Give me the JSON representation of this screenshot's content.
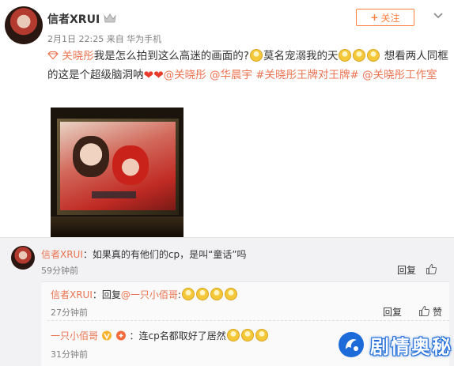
{
  "post": {
    "author": "信者XRUI",
    "meta": "2月1日 22:25 来自 华为手机",
    "follow_label": "关注",
    "tag_link": "关晓彤",
    "text_1": "我是怎么拍到这么高迷的画面的?",
    "text_2": "莫名宠溺我的天",
    "text_3": " 想看两人同框的这是个超级脑洞呐",
    "mentions": [
      "@关晓彤",
      "@华晨宇",
      "#关晓彤王牌对王牌#",
      "@关晓彤工作室"
    ]
  },
  "comment": {
    "author": "信者XRUI",
    "text": "：如果真的有他们的cp，是叫“童话”吗",
    "time": "59分钟前",
    "reply_label": "回复"
  },
  "replies": [
    {
      "author": "信者XRUI",
      "prefix": "：回复",
      "target": "@一只小佰哥",
      "text": ":",
      "time": "27分钟前",
      "reply_label": "回复",
      "like_label": "赞"
    },
    {
      "author": "一只小佰哥",
      "text": "：连cp名都取好了居然",
      "time": "31分钟前"
    }
  ],
  "watermark": {
    "text": "剧情奥秘"
  },
  "colors": {
    "link": "#eb7350",
    "follow": "#ff8140",
    "watermark": "#1d6bd8"
  }
}
